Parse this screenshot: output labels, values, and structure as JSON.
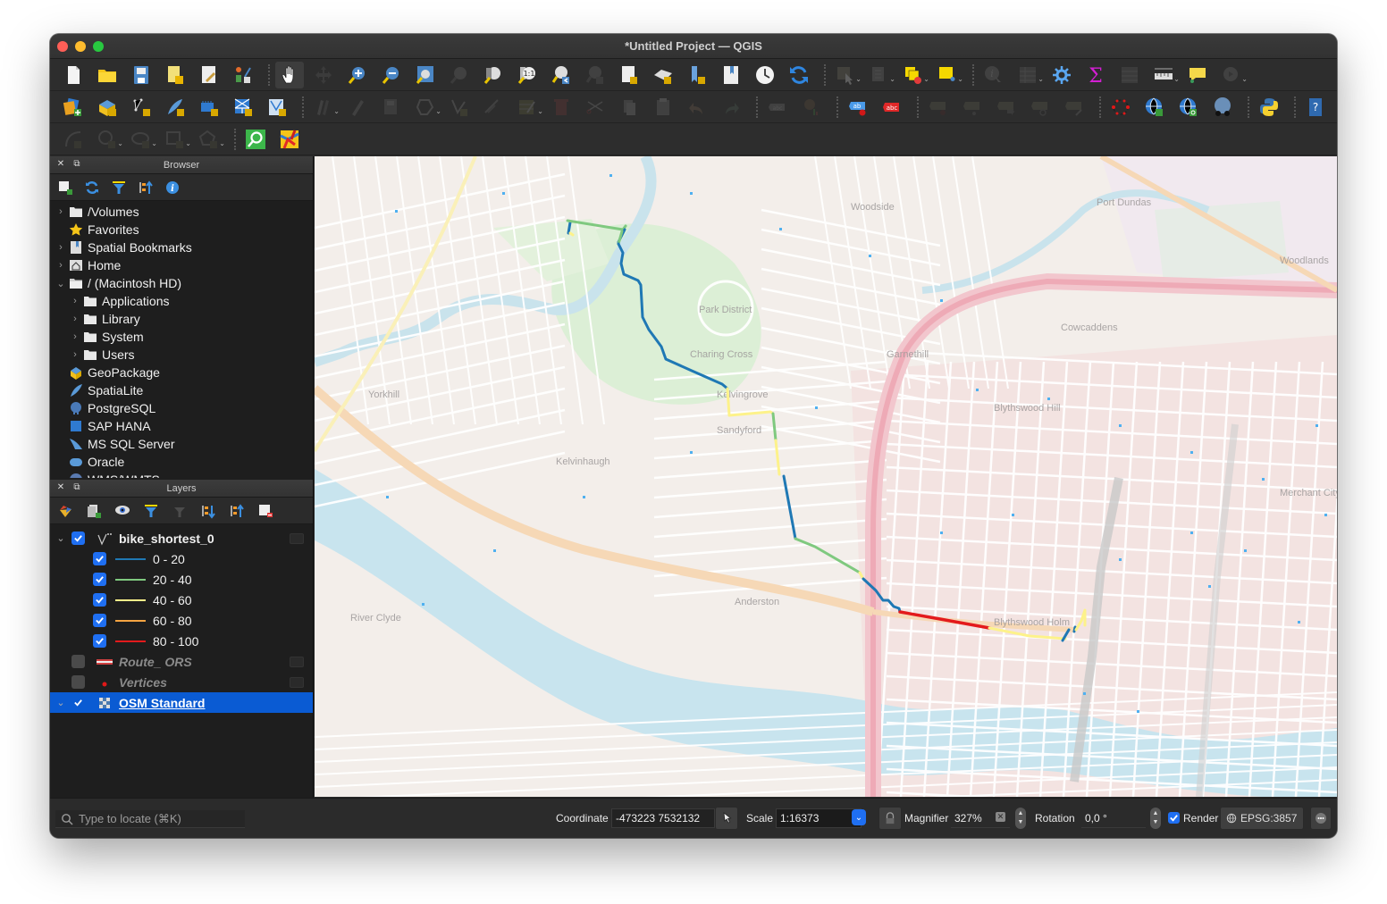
{
  "window": {
    "title": "*Untitled Project — QGIS"
  },
  "toolbars": {
    "row1": [
      {
        "icon": "new-project-icon",
        "label": "New Project"
      },
      {
        "icon": "open-project-icon",
        "label": "Open Project"
      },
      {
        "icon": "save-project-icon",
        "label": "Save Project"
      },
      {
        "icon": "new-print-layout-icon",
        "label": "New Print Layout"
      },
      {
        "icon": "style-manager-icon",
        "label": "Style Manager"
      },
      {
        "icon": "layout-manager-icon",
        "label": "Layout Manager"
      },
      {
        "icon": "pan-hand-icon",
        "label": "Pan Map"
      },
      {
        "icon": "pan-to-selection-icon",
        "label": "Pan Map to Selection"
      },
      {
        "icon": "zoom-in-icon",
        "label": "Zoom In"
      },
      {
        "icon": "zoom-out-icon",
        "label": "Zoom Out"
      },
      {
        "icon": "zoom-full-icon",
        "label": "Zoom Full"
      },
      {
        "icon": "zoom-to-selection-icon",
        "label": "Zoom to Selection"
      },
      {
        "icon": "zoom-to-layer-icon",
        "label": "Zoom to Layer"
      },
      {
        "icon": "zoom-native-icon",
        "label": "Zoom to Native Resolution"
      },
      {
        "icon": "zoom-last-icon",
        "label": "Zoom Last"
      },
      {
        "icon": "zoom-next-icon",
        "label": "Zoom Next"
      },
      {
        "icon": "new-map-view-icon",
        "label": "New Map View"
      },
      {
        "icon": "new-3d-map-view-icon",
        "label": "New 3D Map View"
      },
      {
        "icon": "new-bookmark-icon",
        "label": "New Spatial Bookmark"
      },
      {
        "icon": "show-bookmarks-icon",
        "label": "Show Spatial Bookmarks"
      },
      {
        "icon": "temporal-controller-icon",
        "label": "Temporal Controller"
      },
      {
        "icon": "refresh-icon",
        "label": "Refresh"
      },
      {
        "icon": "select-features-icon",
        "label": "Select Features"
      },
      {
        "icon": "select-by-value-icon",
        "label": "Select by Value"
      },
      {
        "icon": "deselect-features-icon",
        "label": "Deselect Features"
      },
      {
        "icon": "select-by-location-icon",
        "label": "Select by Location"
      },
      {
        "icon": "identify-features-icon",
        "label": "Identify Features"
      },
      {
        "icon": "attribute-table-icon",
        "label": "Open Attribute Table"
      },
      {
        "icon": "processing-toolbox-icon",
        "label": "Processing Toolbox"
      },
      {
        "icon": "statistical-summary-icon",
        "label": "Statistical Summary"
      },
      {
        "icon": "field-calculator-icon",
        "label": "Open Field Calculator"
      },
      {
        "icon": "measure-line-icon",
        "label": "Measure Line"
      },
      {
        "icon": "map-tips-icon",
        "label": "Show Map Tips"
      },
      {
        "icon": "actions-icon",
        "label": "Run Feature Action"
      }
    ],
    "row2": [
      {
        "icon": "data-source-manager-icon",
        "label": "Open Data Source Manager"
      },
      {
        "icon": "new-geopackage-layer-icon",
        "label": "New GeoPackage Layer"
      },
      {
        "icon": "new-shapefile-layer-icon",
        "label": "New Shapefile Layer"
      },
      {
        "icon": "new-spatialite-layer-icon",
        "label": "New SpatiaLite Layer"
      },
      {
        "icon": "new-temporary-layer-icon",
        "label": "New Temporary Scratch Layer"
      },
      {
        "icon": "new-virtual-layer-icon",
        "label": "New Virtual Layer"
      },
      {
        "icon": "new-mesh-layer-icon",
        "label": "New Mesh Layer"
      },
      {
        "icon": "current-edits-icon",
        "label": "Current Edits"
      },
      {
        "icon": "toggle-editing-icon",
        "label": "Toggle Editing"
      },
      {
        "icon": "save-edits-icon",
        "label": "Save Layer Edits"
      },
      {
        "icon": "add-polygon-icon",
        "label": "Add Polygon Feature"
      },
      {
        "icon": "vertex-tool-icon",
        "label": "Vertex Tool"
      },
      {
        "icon": "modify-attributes-icon",
        "label": "Modify Attributes"
      },
      {
        "icon": "multi-edit-icon",
        "label": "Toggle Multi Edit"
      },
      {
        "icon": "delete-selected-icon",
        "label": "Delete Selected"
      },
      {
        "icon": "cut-features-icon",
        "label": "Cut Features"
      },
      {
        "icon": "copy-features-icon",
        "label": "Copy Features"
      },
      {
        "icon": "paste-features-icon",
        "label": "Paste Features"
      },
      {
        "icon": "undo-icon",
        "label": "Undo"
      },
      {
        "icon": "redo-icon",
        "label": "Redo"
      },
      {
        "icon": "label-toolbar-icon",
        "label": "Labeling"
      },
      {
        "icon": "diagram-options-icon",
        "label": "Diagram Options"
      },
      {
        "icon": "highlight-pinned-labels-icon",
        "label": "Highlight Pinned Labels"
      },
      {
        "icon": "toggle-label-display-icon",
        "label": "Toggle Display of Unplaced Labels"
      },
      {
        "icon": "pin-labels-icon",
        "label": "Pin/Unpin Labels"
      },
      {
        "icon": "show-hide-labels-icon",
        "label": "Show/Hide Labels"
      },
      {
        "icon": "move-label-icon",
        "label": "Move Label"
      },
      {
        "icon": "rotate-label-icon",
        "label": "Rotate Label"
      },
      {
        "icon": "change-label-icon",
        "label": "Change Label Properties"
      },
      {
        "icon": "georeferencer-icon",
        "label": "Georeferencer"
      },
      {
        "icon": "add-wms-layer-icon",
        "label": "Add WMS Layer"
      },
      {
        "icon": "metasearch-icon",
        "label": "MetaSearch"
      },
      {
        "icon": "browse-web-icon",
        "label": "Browse Web Services"
      },
      {
        "icon": "python-console-icon",
        "label": "Python Console"
      },
      {
        "icon": "help-icon",
        "label": "Help"
      }
    ],
    "row3": [
      {
        "icon": "digitize-curve-icon",
        "label": "Digitize Curve"
      },
      {
        "icon": "add-circle-icon",
        "label": "Add Circle"
      },
      {
        "icon": "add-ellipse-icon",
        "label": "Add Ellipse"
      },
      {
        "icon": "add-rectangle-icon",
        "label": "Add Rectangle"
      },
      {
        "icon": "add-regular-polygon-icon",
        "label": "Add Regular Polygon"
      },
      {
        "icon": "locator-search-icon",
        "label": "Locator Search"
      },
      {
        "icon": "plugin-map-icon",
        "label": "Plugin"
      }
    ]
  },
  "browser": {
    "title": "Browser",
    "items": [
      {
        "label": "/Volumes",
        "icon": "folder-icon",
        "expandable": true,
        "expanded": false,
        "indent": 0
      },
      {
        "label": "Favorites",
        "icon": "star-icon",
        "expandable": false,
        "indent": 0
      },
      {
        "label": "Spatial Bookmarks",
        "icon": "bookmark-icon",
        "expandable": true,
        "expanded": false,
        "indent": 0
      },
      {
        "label": "Home",
        "icon": "home-folder-icon",
        "expandable": true,
        "expanded": false,
        "indent": 0
      },
      {
        "label": "/ (Macintosh HD)",
        "icon": "open-folder-icon",
        "expandable": true,
        "expanded": true,
        "indent": 0
      },
      {
        "label": "Applications",
        "icon": "folder-icon",
        "expandable": true,
        "expanded": false,
        "indent": 1
      },
      {
        "label": "Library",
        "icon": "folder-icon",
        "expandable": true,
        "expanded": false,
        "indent": 1
      },
      {
        "label": "System",
        "icon": "folder-icon",
        "expandable": true,
        "expanded": false,
        "indent": 1
      },
      {
        "label": "Users",
        "icon": "folder-icon",
        "expandable": true,
        "expanded": false,
        "indent": 1
      },
      {
        "label": "GeoPackage",
        "icon": "geopackage-icon",
        "expandable": false,
        "indent": 0
      },
      {
        "label": "SpatiaLite",
        "icon": "spatialite-icon",
        "expandable": false,
        "indent": 0
      },
      {
        "label": "PostgreSQL",
        "icon": "postgresql-icon",
        "expandable": false,
        "indent": 0
      },
      {
        "label": "SAP HANA",
        "icon": "sap-hana-icon",
        "expandable": false,
        "indent": 0
      },
      {
        "label": "MS SQL Server",
        "icon": "mssql-icon",
        "expandable": false,
        "indent": 0
      },
      {
        "label": "Oracle",
        "icon": "oracle-icon",
        "expandable": false,
        "indent": 0
      },
      {
        "label": "WMS/WMTS",
        "icon": "wms-icon",
        "expandable": false,
        "indent": 0
      }
    ]
  },
  "layers": {
    "title": "Layers",
    "tree": [
      {
        "name": "bike_shortest_0",
        "type": "line-layer",
        "checked": true,
        "expanded": true,
        "style": "bold",
        "classes": [
          {
            "label": "0 - 20",
            "color": "#1f78b4",
            "checked": true
          },
          {
            "label": "20 - 40",
            "color": "#7fc97f",
            "checked": true
          },
          {
            "label": "40 - 60",
            "color": "#fdf28a",
            "checked": true
          },
          {
            "label": "60 - 80",
            "color": "#f5a442",
            "checked": true
          },
          {
            "label": "80 - 100",
            "color": "#e31a1c",
            "checked": true
          }
        ]
      },
      {
        "name": "Route_ ORS",
        "type": "line-layer",
        "checked": false,
        "style": "disabled"
      },
      {
        "name": "Vertices",
        "type": "point-layer",
        "checked": false,
        "style": "disabled"
      },
      {
        "name": "OSM Standard",
        "type": "raster-layer",
        "checked": true,
        "expanded": true,
        "selected": true,
        "style": "link"
      }
    ]
  },
  "map": {
    "route_segments": [
      {
        "class": "0 - 20",
        "color": "#1f78b4"
      },
      {
        "class": "20 - 40",
        "color": "#7fc97f"
      },
      {
        "class": "40 - 60",
        "color": "#fdf28a"
      },
      {
        "class": "80 - 100",
        "color": "#e31a1c"
      }
    ],
    "place_labels": [
      "Park District",
      "Kelvingrove",
      "Sandyford",
      "Anderston",
      "Woodlands",
      "Woodside",
      "Cowcaddens",
      "Garnethill",
      "Blythswood Hill",
      "Blythswood Holm",
      "Port Dundas",
      "Yorkhill",
      "River Clyde",
      "Kelvinhaugh",
      "Charing Cross",
      "Merchant City"
    ]
  },
  "statusbar": {
    "locate_placeholder": "Type to locate (⌘K)",
    "coordinate_label": "Coordinate",
    "coordinate_value": "-473223  7532132",
    "scale_label": "Scale",
    "scale_value": "1:16373",
    "magnifier_label": "Magnifier",
    "magnifier_value": "327%",
    "rotation_label": "Rotation",
    "rotation_value": "0,0 °",
    "render_label": "Render",
    "render_checked": true,
    "crs_label": "EPSG:3857"
  }
}
